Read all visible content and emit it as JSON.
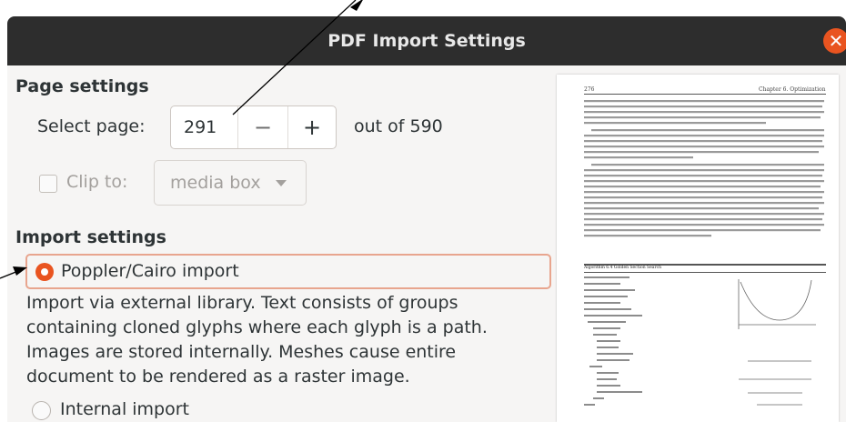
{
  "window": {
    "title": "PDF Import Settings"
  },
  "page_settings": {
    "heading": "Page settings",
    "select_page_label": "Select page:",
    "page_value": "291",
    "minus": "−",
    "plus": "+",
    "out_of": "out of 590",
    "clip_label": "Clip to:",
    "clip_value": "media box"
  },
  "import_settings": {
    "heading": "Import settings",
    "option1_label": "Poppler/Cairo import",
    "option1_description": [
      "Import via external library. Text consists of groups",
      "containing cloned glyphs where each glyph is a path.",
      "Images are stored internally. Meshes cause entire",
      "document to be rendered as a raster image."
    ],
    "option2_label": "Internal import"
  },
  "preview": {
    "page_number": "276",
    "chapter": "Chapter 6. Optimization",
    "algorithm_title": "Algorithm 6.4 Golden Section Search"
  },
  "icons": {
    "close": "close-icon",
    "caret": "chevron-down-icon"
  },
  "colors": {
    "accent": "#e95420",
    "titlebar": "#2d2d2d"
  }
}
